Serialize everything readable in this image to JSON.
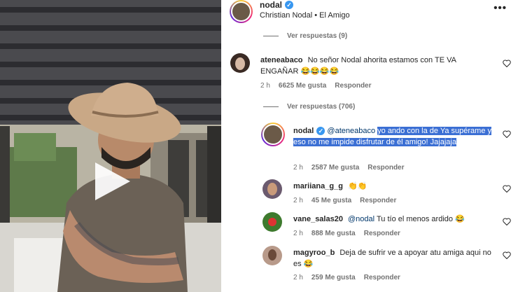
{
  "post": {
    "username": "nodal",
    "subtitle": "Christian Nodal • El Amigo"
  },
  "view_replies_1": "Ver respuestas (9)",
  "view_replies_2": "Ver respuestas (706)",
  "comments": [
    {
      "username": "ateneabaco",
      "text": "No señor Nodal ahorita estamos con TE VA ENGAÑAR 😂😂😂😂",
      "time": "2 h",
      "likes": "6625 Me gusta",
      "reply": "Responder"
    },
    {
      "username": "nodal",
      "mention": "@ateneabaco",
      "text": "yo ando con la de Ya supérame y eso no me impide disfrutar de él amigo! Jajajaja",
      "time": "2 h",
      "likes": "2587 Me gusta",
      "reply": "Responder"
    },
    {
      "username": "mariiana_g_g",
      "text": "👏👏",
      "time": "2 h",
      "likes": "45 Me gusta",
      "reply": "Responder"
    },
    {
      "username": "vane_salas20",
      "mention": "@nodal",
      "text": "Tu tío el menos ardido 😂",
      "time": "2 h",
      "likes": "888 Me gusta",
      "reply": "Responder"
    },
    {
      "username": "magyroo_b",
      "text": "Deja de sufrir ve a apoyar atu amiga aqui no es 😂",
      "time": "2 h",
      "likes": "259 Me gusta",
      "reply": "Responder"
    }
  ],
  "icons": {
    "more": "more-options-icon",
    "like": "heart-icon",
    "verified": "verified-badge-icon",
    "play": "play-icon"
  },
  "colors": {
    "highlight": "#3b6fd4",
    "verified": "#3897f0",
    "meta": "#737373"
  }
}
